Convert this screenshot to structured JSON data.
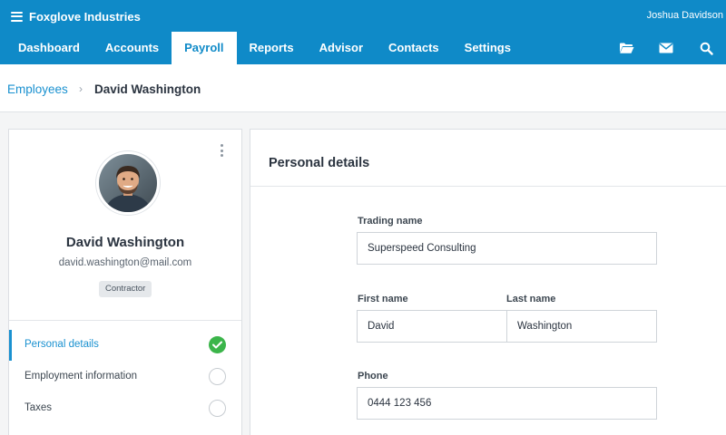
{
  "app": {
    "brand": "Foxglove Industries",
    "user": "Joshua Davidson"
  },
  "nav": {
    "items": [
      "Dashboard",
      "Accounts",
      "Payroll",
      "Reports",
      "Advisor",
      "Contacts",
      "Settings"
    ],
    "active": "Payroll",
    "icons": [
      "folder-icon",
      "mail-icon",
      "search-icon"
    ]
  },
  "breadcrumb": {
    "parent": "Employees",
    "separator": "›",
    "current": "David Washington"
  },
  "profile": {
    "name": "David Washington",
    "email": "david.washington@mail.com",
    "role_badge": "Contractor",
    "sections": [
      {
        "label": "Personal details",
        "complete": true,
        "active": true
      },
      {
        "label": "Employment information",
        "complete": false,
        "active": false
      },
      {
        "label": "Taxes",
        "complete": false,
        "active": false
      }
    ]
  },
  "details": {
    "title": "Personal details",
    "trading_name": {
      "label": "Trading name",
      "value": "Superspeed Consulting"
    },
    "first_name": {
      "label": "First name",
      "value": "David"
    },
    "last_name": {
      "label": "Last name",
      "value": "Washington"
    },
    "phone": {
      "label": "Phone",
      "value": "0444 123 456"
    }
  },
  "colors": {
    "brand": "#0f8ac8",
    "link": "#1a91d0",
    "success": "#3bb54a"
  }
}
